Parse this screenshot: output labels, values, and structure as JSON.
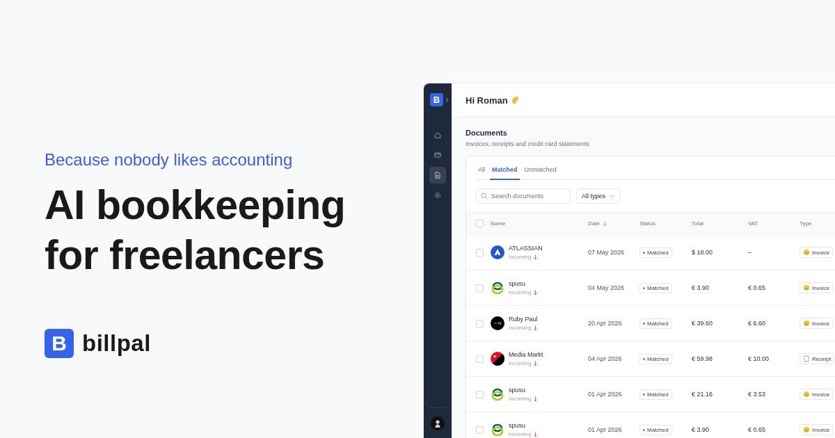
{
  "hero": {
    "tagline": "Because nobody likes accounting",
    "headline_lines": [
      "AI bookkeeping",
      "for freelancers"
    ],
    "brand": {
      "mark": "B",
      "name": "billpal"
    }
  },
  "app": {
    "sidebar": {
      "logo_mark": "B",
      "items": [
        {
          "kind": "home",
          "selected": false
        },
        {
          "kind": "card",
          "selected": false
        },
        {
          "kind": "document",
          "selected": true
        },
        {
          "kind": "settings",
          "selected": false
        }
      ]
    },
    "greeting": "Hi Roman",
    "section": {
      "title": "Documents",
      "subtitle": "Invoices, receipts and credit card statements"
    },
    "tabs": [
      {
        "label": "All",
        "selected": false
      },
      {
        "label": "Matched",
        "selected": true
      },
      {
        "label": "Unmatched",
        "selected": false
      }
    ],
    "search": {
      "placeholder": "Search documents"
    },
    "filter": {
      "value": "All types"
    },
    "table": {
      "all_checked": false,
      "columns": [
        {
          "label": "Name",
          "sorted": false
        },
        {
          "label": "Date",
          "sorted": true
        },
        {
          "label": "Status",
          "sorted": false
        },
        {
          "label": "Total",
          "sorted": false
        },
        {
          "label": "VAT",
          "sorted": false
        },
        {
          "label": "Type",
          "sorted": false
        }
      ],
      "rows": [
        {
          "logo": {
            "kind": "triangle"
          },
          "name": "ATLASSIAN",
          "direction": "Incoming",
          "date": "07 May 2026",
          "status": "Matched",
          "total": "$ 18.00",
          "vat": "–",
          "type": {
            "kind": "invoice",
            "label": "Invoice"
          },
          "checked": false
        },
        {
          "logo": {
            "kind": "rings"
          },
          "name": "spusu",
          "direction": "Incoming",
          "date": "04 May 2026",
          "status": "Matched",
          "total": "€ 3.90",
          "vat": "€ 0.65",
          "type": {
            "kind": "invoice",
            "label": "Invoice"
          },
          "checked": false
        },
        {
          "logo": {
            "kind": "dark"
          },
          "name": "Ruby Paul",
          "direction": "Incoming",
          "date": "20 Apr 2026",
          "status": "Matched",
          "total": "€ 39.60",
          "vat": "€ 6.60",
          "type": {
            "kind": "invoice",
            "label": "Invoice"
          },
          "checked": false
        },
        {
          "logo": {
            "kind": "split"
          },
          "name": "Media Markt",
          "direction": "Incoming",
          "date": "04 Apr 2026",
          "status": "Matched",
          "total": "€ 59.98",
          "vat": "€ 10.00",
          "type": {
            "kind": "receipt",
            "label": "Receipt"
          },
          "checked": false
        },
        {
          "logo": {
            "kind": "rings"
          },
          "name": "spusu",
          "direction": "Incoming",
          "date": "01 Apr 2026",
          "status": "Matched",
          "total": "€ 21.16",
          "vat": "€ 3.53",
          "type": {
            "kind": "invoice",
            "label": "Invoice"
          },
          "checked": false
        },
        {
          "logo": {
            "kind": "rings"
          },
          "name": "spusu",
          "direction": "Incoming",
          "date": "01 Apr 2026",
          "status": "Matched",
          "total": "€ 3.90",
          "vat": "€ 0.65",
          "type": {
            "kind": "invoice",
            "label": "Invoice"
          },
          "checked": false
        }
      ]
    }
  }
}
